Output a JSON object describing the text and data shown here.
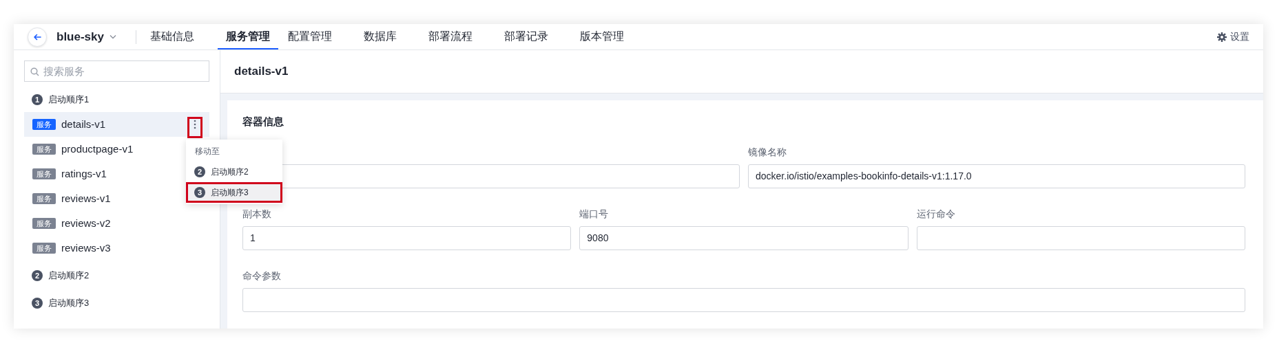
{
  "nav": {
    "project": "blue-sky",
    "tabs": [
      {
        "label": "基础信息",
        "selected": false
      },
      {
        "label": "服务管理",
        "selected": true
      },
      {
        "label": "配置管理",
        "selected": false
      },
      {
        "label": "数据库",
        "selected": false
      },
      {
        "label": "部署流程",
        "selected": false
      },
      {
        "label": "部署记录",
        "selected": false
      },
      {
        "label": "版本管理",
        "selected": false
      }
    ],
    "settings": "设置"
  },
  "sidebar": {
    "search": {
      "placeholder": "搜索服务"
    },
    "groups": [
      {
        "number": "1",
        "label": "启动顺序1",
        "services": [
          {
            "tag": "服务",
            "name": "details-v1",
            "selected": true,
            "menu_open": true,
            "menu_annotated": true
          },
          {
            "tag": "服务",
            "name": "productpage-v1",
            "selected": false
          },
          {
            "tag": "服务",
            "name": "ratings-v1",
            "selected": false
          },
          {
            "tag": "服务",
            "name": "reviews-v1",
            "selected": false
          },
          {
            "tag": "服务",
            "name": "reviews-v2",
            "selected": false
          },
          {
            "tag": "服务",
            "name": "reviews-v3",
            "selected": false
          }
        ]
      },
      {
        "number": "2",
        "label": "启动顺序2"
      },
      {
        "number": "3",
        "label": "启动顺序3"
      }
    ]
  },
  "menu": {
    "title": "移动至",
    "items": [
      {
        "number": "2",
        "label": "启动顺序2",
        "selected": false,
        "annotated": false
      },
      {
        "number": "3",
        "label": "启动顺序3",
        "selected": true,
        "annotated": true
      }
    ]
  },
  "content": {
    "title": "details-v1",
    "section": "容器信息",
    "fields": [
      {
        "kind": "half"
      },
      {
        "kind": "half",
        "label": "镜像名称",
        "value": "docker.io/istio/examples-bookinfo-details-v1:1.17.0"
      },
      {
        "kind": "third",
        "label": "副本数",
        "value": "1"
      },
      {
        "kind": "third",
        "label": "端口号",
        "value": "9080"
      },
      {
        "kind": "third",
        "label": "运行命令"
      },
      {
        "kind": "full",
        "label": "命令参数"
      }
    ]
  }
}
